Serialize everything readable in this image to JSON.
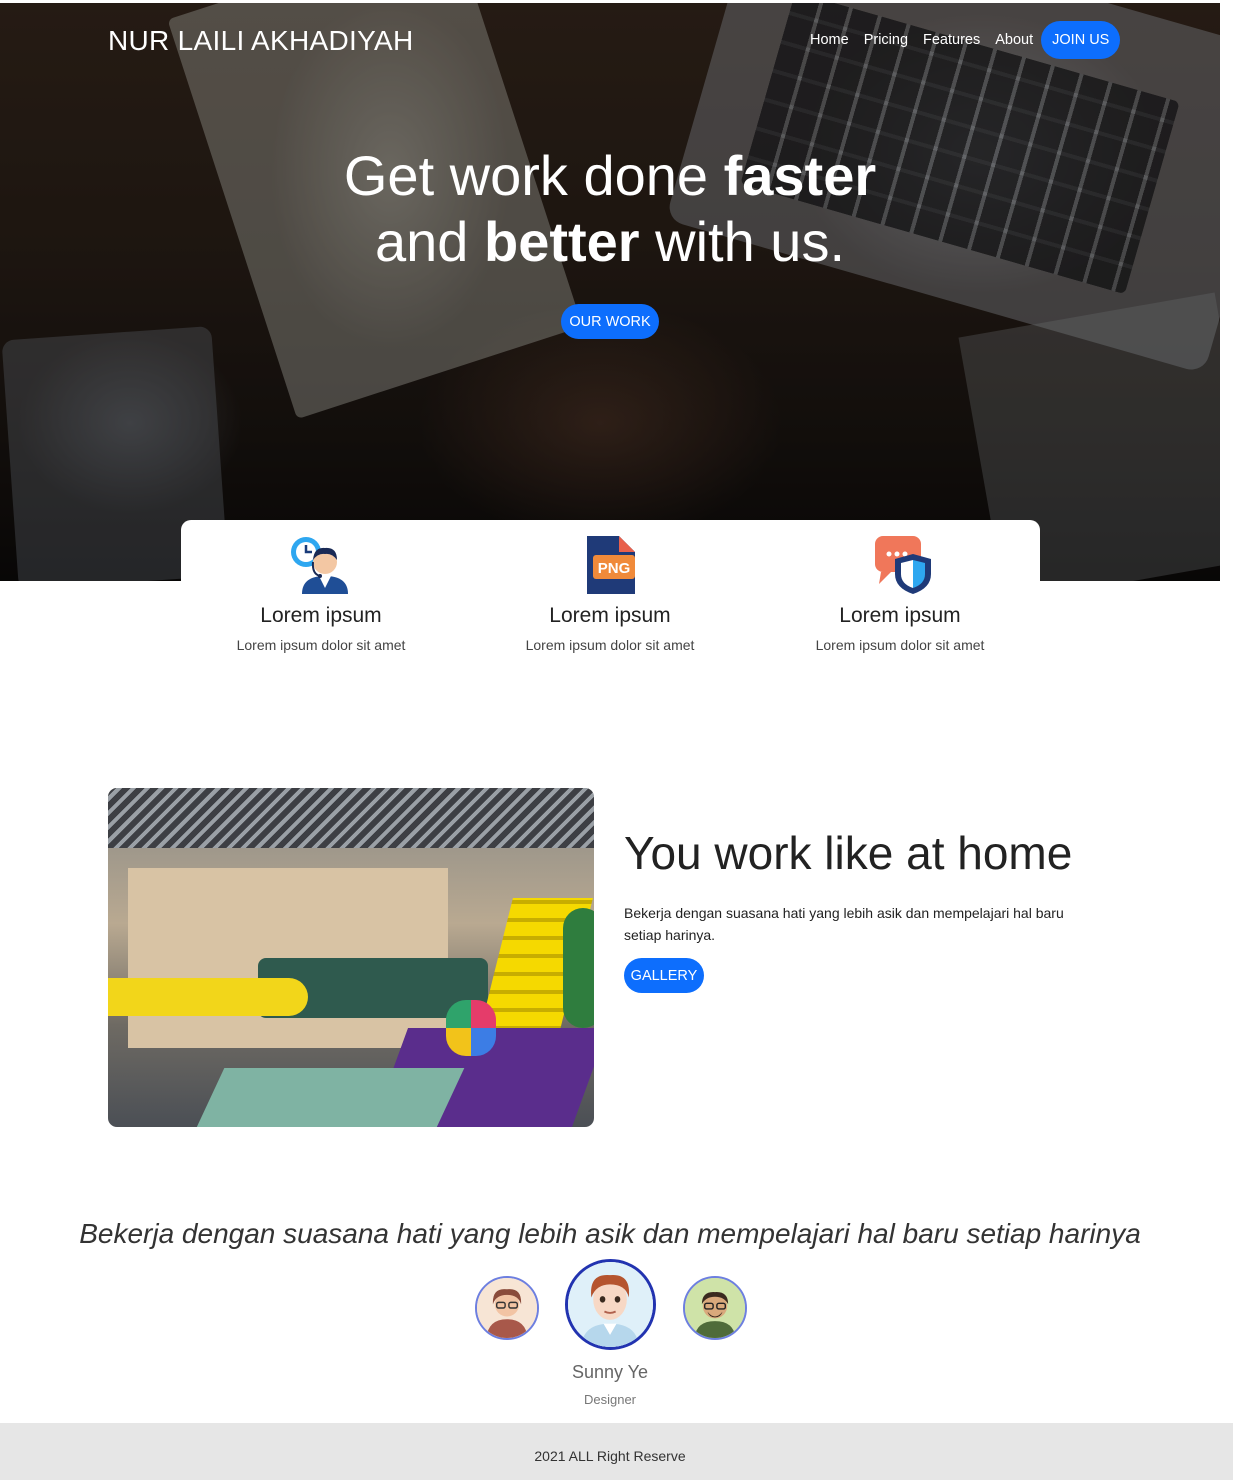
{
  "header": {
    "brand": "NUR LAILI AKHADIYAH",
    "nav": [
      "Home",
      "Pricing",
      "Features",
      "About"
    ],
    "join_label": "JOIN US"
  },
  "hero": {
    "line1_light": "Get work done ",
    "line1_bold": "faster",
    "line2_light_a": "and ",
    "line2_bold": "better",
    "line2_light_b": " with us.",
    "cta_label": "OUR WORK"
  },
  "features": [
    {
      "icon": "customer-service-icon",
      "title": "Lorem ipsum",
      "text": "Lorem ipsum dolor sit amet"
    },
    {
      "icon": "png-file-icon",
      "title": "Lorem ipsum",
      "text": "Lorem ipsum dolor sit amet",
      "badge": "PNG"
    },
    {
      "icon": "secure-chat-icon",
      "title": "Lorem ipsum",
      "text": "Lorem ipsum dolor sit amet"
    }
  ],
  "work": {
    "title_parts": [
      "You ",
      "work",
      " like at ",
      "home"
    ],
    "description": "Bekerja dengan suasana hati yang lebih asik dan mempelajari hal baru setiap harinya.",
    "button_label": "GALLERY"
  },
  "testimonial": {
    "quote": "Bekerja dengan suasana hati yang lebih asik dan mempelajari hal baru setiap harinya",
    "name": "Sunny Ye",
    "role": "Designer"
  },
  "footer": {
    "text": "2021 ALL Right Reserve"
  },
  "colors": {
    "primary": "#0d6efd",
    "footer_bg": "#e6e6e6",
    "avatar_border": "#2233b0"
  }
}
